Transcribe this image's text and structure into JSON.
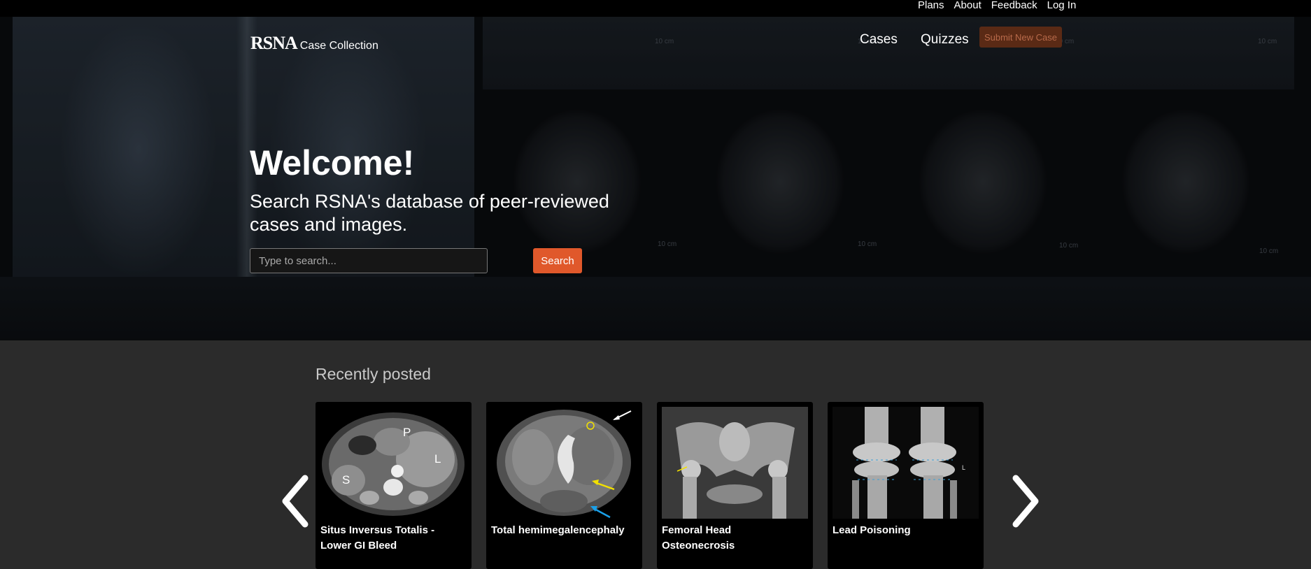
{
  "topbar": {
    "links": [
      "Plans",
      "About",
      "Feedback",
      "Log In"
    ]
  },
  "header": {
    "logo_mark": "RSNA",
    "logo_text": "Case Collection",
    "nav": {
      "cases": "Cases",
      "quizzes": "Quizzes",
      "submit": "Submit New Case"
    }
  },
  "hero": {
    "title": "Welcome!",
    "subtitle": "Search RSNA's database of peer-reviewed cases and images.",
    "scale_label": "10 cm",
    "search": {
      "placeholder": "Type to search...",
      "button": "Search"
    }
  },
  "recent": {
    "title": "Recently posted",
    "cards": [
      {
        "title": "Situs Inversus Totalis - Lower GI Bleed",
        "labels": [
          "P",
          "L",
          "S"
        ]
      },
      {
        "title": "Total hemimegalencephaly"
      },
      {
        "title": "Femoral Head Osteonecrosis"
      },
      {
        "title": "Lead Poisoning",
        "labels": [
          "L"
        ]
      }
    ]
  },
  "colors": {
    "accent": "#e0582b",
    "page_bg": "#2b2b2b",
    "topbar_bg": "#000000"
  },
  "icons": [
    "chevron-left-icon",
    "chevron-right-icon"
  ]
}
